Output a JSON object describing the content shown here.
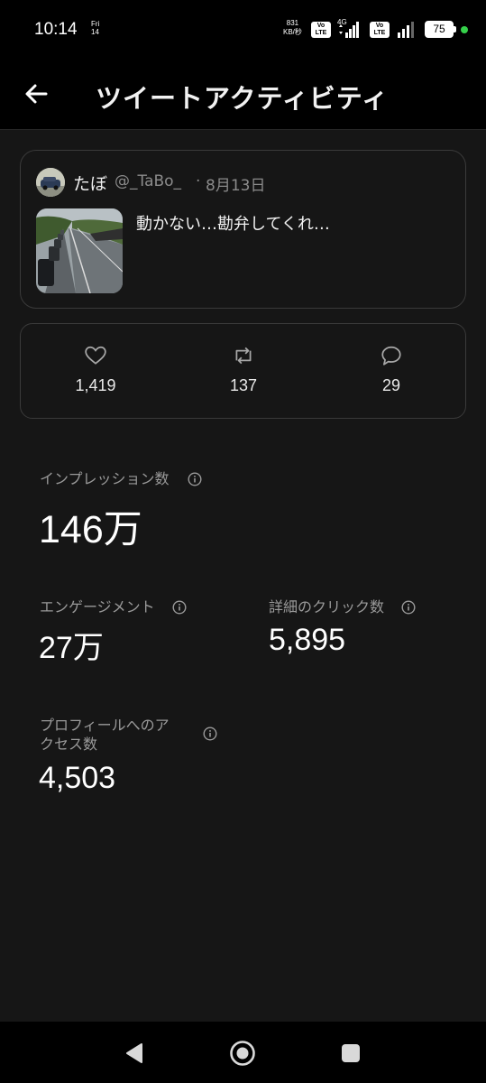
{
  "status_bar": {
    "time": "10:14",
    "day": "Fri",
    "date": "14",
    "speed_value": "831",
    "speed_unit": "KB/秒",
    "volte": "Vo LTE",
    "network": "4G",
    "battery": "75",
    "dot_color": "#35d04a"
  },
  "header": {
    "title": "ツイートアクティビティ",
    "back_icon": "arrow-left-icon"
  },
  "tweet": {
    "name": "たぼ",
    "handle": "@_TaBo_",
    "separator": "·",
    "date": "8月13日",
    "text": "動かない…勘弁してくれ…"
  },
  "engagement": {
    "likes": "1,419",
    "retweets": "137",
    "replies": "29"
  },
  "metrics": {
    "impressions_label": "インプレッション数",
    "impressions_value": "146万",
    "engagements_label": "エンゲージメント",
    "engagements_value": "27万",
    "detail_clicks_label": "詳細のクリック数",
    "detail_clicks_value": "5,895",
    "profile_visits_label_1": "プロフィールへのア",
    "profile_visits_label_2": "クセス数",
    "profile_visits_value": "4,503"
  },
  "colors": {
    "background": "#161616",
    "card_border": "#3a3a3a",
    "muted_text": "#9a9a9a"
  }
}
